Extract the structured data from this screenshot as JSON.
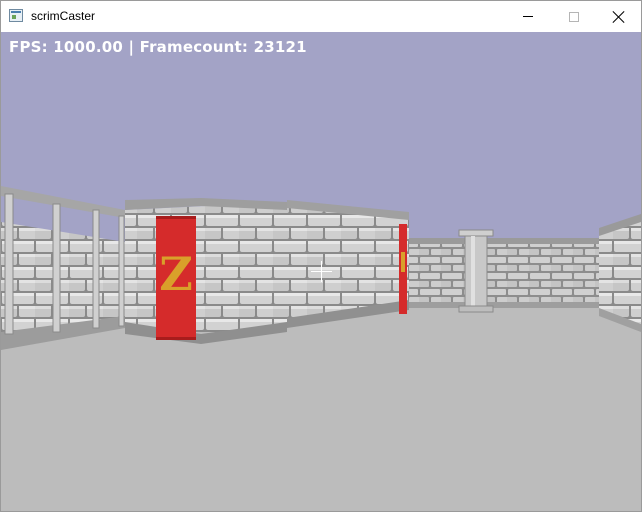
{
  "window": {
    "title": "scrimCaster",
    "icon": "app-window-icon",
    "controls": [
      "minimize-icon",
      "maximize-icon",
      "close-icon"
    ]
  },
  "hud": {
    "fps_label": "FPS:",
    "fps_value": "1000.00",
    "separator": "|",
    "framecount_label": "Framecount:",
    "framecount_value": "23121"
  },
  "scene": {
    "banner_letter": "Z",
    "crosshair": "crosshair-icon"
  },
  "colors": {
    "sky": "#a3a3c6",
    "floor": "#bcbcbc",
    "wall_stone": "#c6c6c6",
    "banner_red": "#d52b2b",
    "banner_letter": "#d9a02a",
    "hud_text": "#ffffff"
  }
}
